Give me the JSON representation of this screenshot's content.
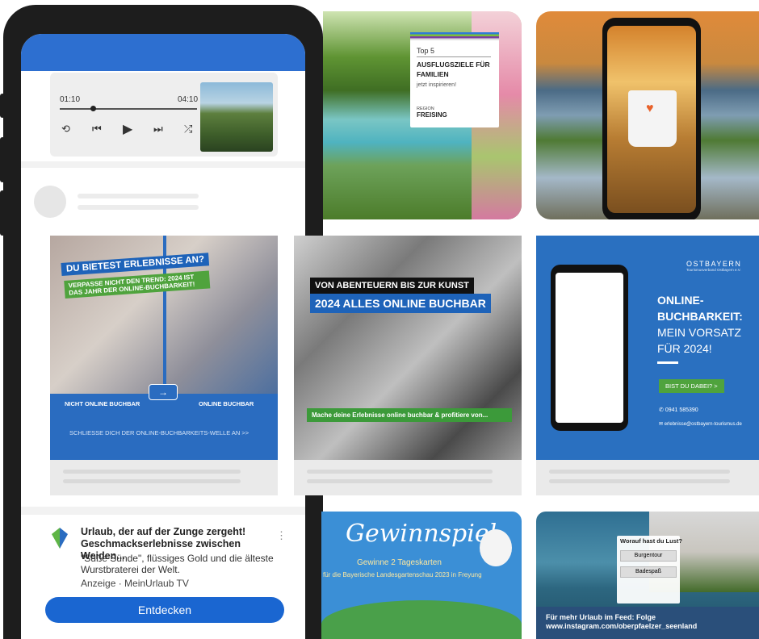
{
  "player": {
    "elapsed": "01:10",
    "total": "04:10"
  },
  "ad": {
    "title": "Urlaub, der auf der Zunge zergeht! Geschmackserlebnisse zwischen Weiden...",
    "description": "\"Süße Sünde\", flüssiges Gold und die älteste Wurstbraterei der Welt.",
    "meta": "Anzeige · MeinUrlaub TV",
    "cta": "Entdecken",
    "more": "⋮"
  },
  "tiles": {
    "top5": {
      "label": "Top 5",
      "title": "AUSFLUGSZIELE FÜR FAMILIEN",
      "subtitle": "jetzt inspirieren!",
      "region_small": "REGION",
      "region": "FREISING"
    },
    "buchbar": {
      "headline": "DU BIETEST ERLEBNISSE AN?",
      "subheadline": "VERPASSE NICHT DEN TREND: 2024 IST DAS JAHR DER ONLINE-BUCHBARKEIT!",
      "left_label": "NICHT ONLINE BUCHBAR",
      "right_label": "ONLINE BUCHBAR",
      "arrow": "→",
      "footer": "SCHLIESSE DICH DER ONLINE-BUCHBARKEITS-WELLE AN >>"
    },
    "collage": {
      "line1": "VON ABENTEUERN BIS ZUR KUNST",
      "line2": "2024 ALLES ONLINE BUCHBAR",
      "footer": "Mache deine Erlebnisse online buchbar & profitiere von..."
    },
    "ostbayern": {
      "logo": "OSTBAYERN",
      "logo_sub": "Tourismusverband Ostbayern e.V.",
      "headline_1": "ONLINE-",
      "headline_2": "BUCHBARKEIT:",
      "headline_3": "MEIN VORSATZ",
      "headline_4": "FÜR 2024!",
      "button": "BIST DU DABEI?  >",
      "phone": "0941 585390",
      "email": "erlebnisse@ostbayern-tourismus.de"
    },
    "gewinnspiel": {
      "title": "Gewinnspiel",
      "subtitle": "Gewinne 2 Tageskarten",
      "subtitle2": "für die Bayerische Landesgartenschau 2023 in Freyung"
    },
    "seenland": {
      "question": "Worauf hast du Lust?",
      "option1": "Burgentour",
      "option2": "Badespaß",
      "footer1": "Für mehr Urlaub im Feed: Folge",
      "footer2": "www.instagram.com/oberpfaelzer_seenland"
    }
  },
  "icons": {
    "repeat": "⟲",
    "prev": "⏮",
    "play": "▶",
    "next": "⏭",
    "shuffle": "⤮",
    "phone": "✆",
    "mail": "✉"
  }
}
